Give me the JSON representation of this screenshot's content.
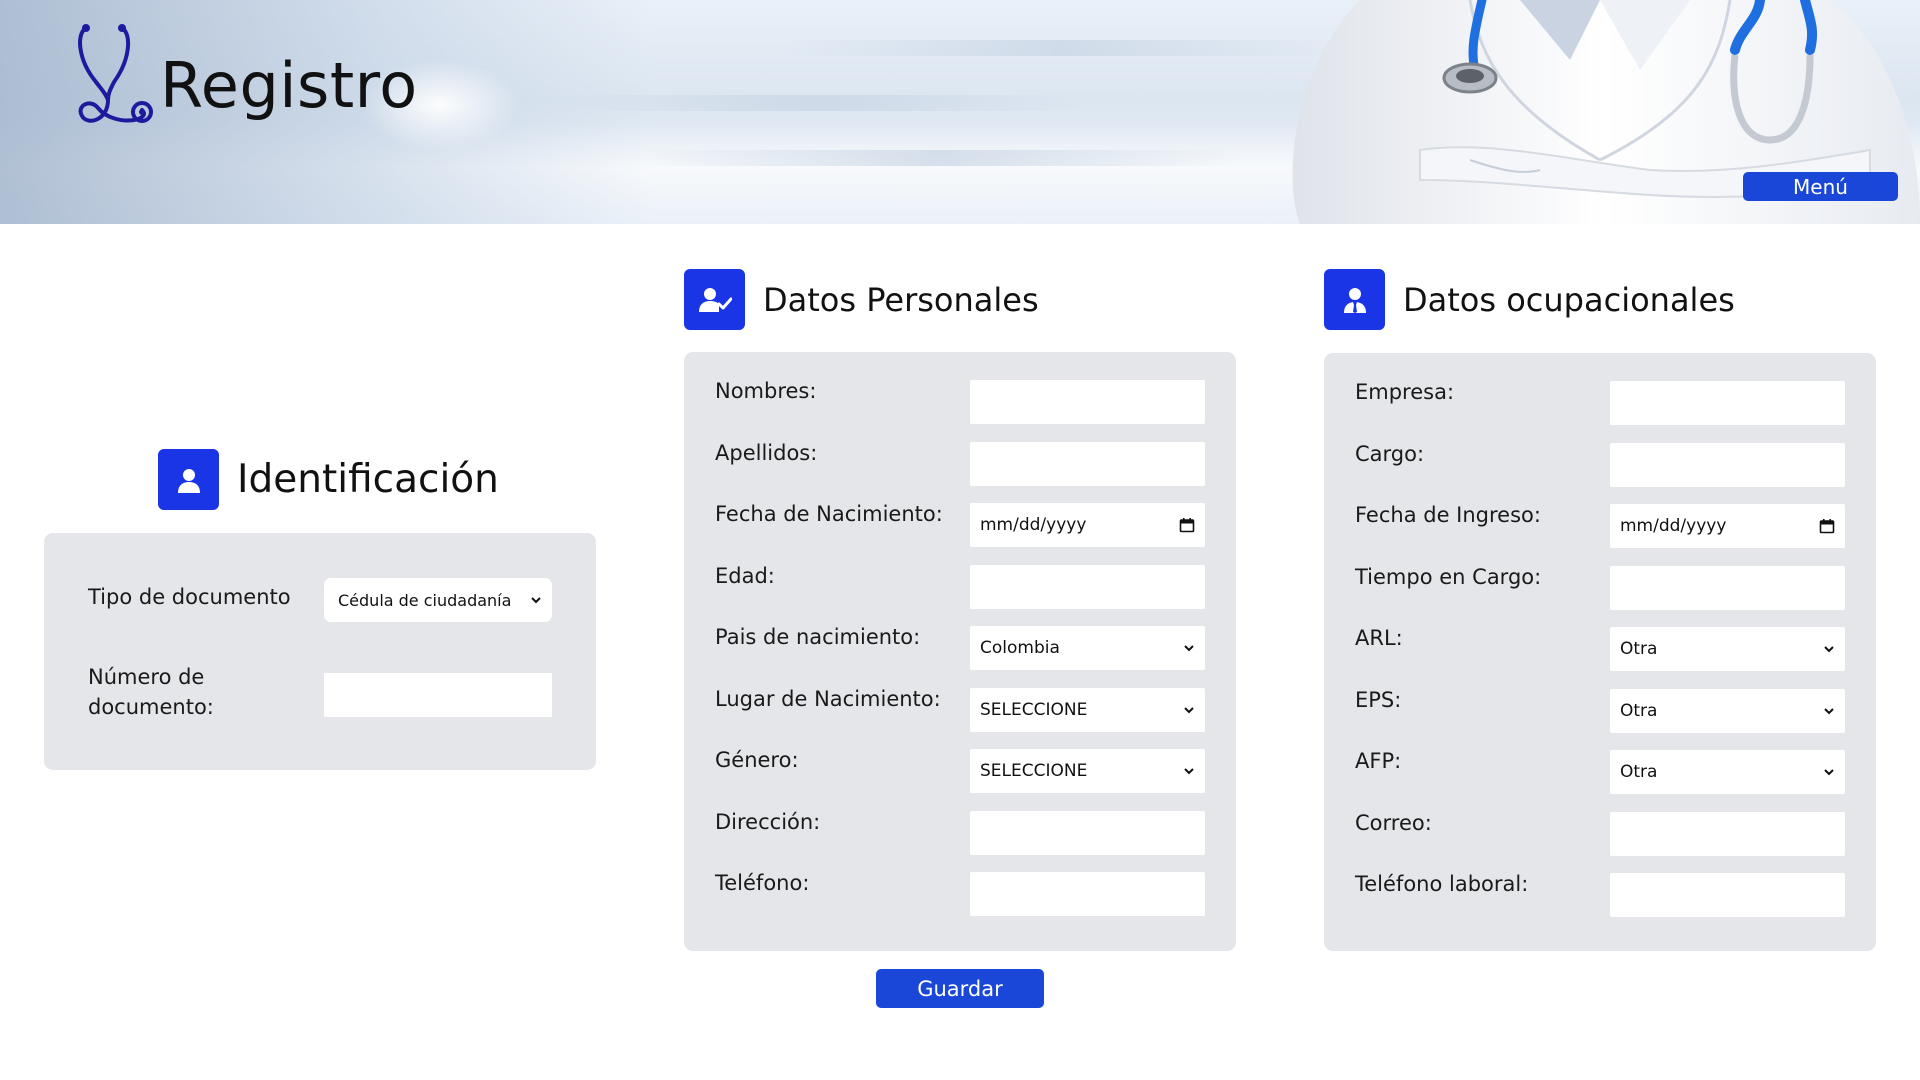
{
  "header": {
    "title": "Registro",
    "menu_label": "Menú"
  },
  "identificacion": {
    "title": "Identificación",
    "icon": "user-icon",
    "tipo_label": "Tipo de documento",
    "tipo_value": "Cédula de ciudadanía",
    "numero_label_line1": "Número de",
    "numero_label_line2": "documento:",
    "numero_value": ""
  },
  "personales": {
    "title": "Datos Personales",
    "icon": "user-check-icon",
    "fields": [
      {
        "label": "Nombres:",
        "type": "text",
        "value": ""
      },
      {
        "label": "Apellidos:",
        "type": "text",
        "value": ""
      },
      {
        "label": "Fecha de Nacimiento:",
        "type": "date",
        "value": "mm/dd/yyyy"
      },
      {
        "label": "Edad:",
        "type": "text",
        "value": ""
      },
      {
        "label": "Pais de nacimiento:",
        "type": "select",
        "value": "Colombia"
      },
      {
        "label": "Lugar de Nacimiento:",
        "type": "select",
        "value": "SELECCIONE"
      },
      {
        "label": "Género:",
        "type": "select",
        "value": "SELECCIONE"
      },
      {
        "label": "Dirección:",
        "type": "text",
        "value": ""
      },
      {
        "label": "Teléfono:",
        "type": "text",
        "value": ""
      }
    ]
  },
  "ocupacionales": {
    "title": "Datos ocupacionales",
    "icon": "user-tie-icon",
    "fields": [
      {
        "label": "Empresa:",
        "type": "text",
        "value": ""
      },
      {
        "label": "Cargo:",
        "type": "text",
        "value": ""
      },
      {
        "label": "Fecha de Ingreso:",
        "type": "date",
        "value": "mm/dd/yyyy"
      },
      {
        "label": "Tiempo en Cargo:",
        "type": "text",
        "value": ""
      },
      {
        "label": "ARL:",
        "type": "select",
        "value": "Otra"
      },
      {
        "label": "EPS:",
        "type": "select",
        "value": "Otra"
      },
      {
        "label": "AFP:",
        "type": "select",
        "value": "Otra"
      },
      {
        "label": "Correo:",
        "type": "text",
        "value": ""
      },
      {
        "label": "Teléfono laboral:",
        "type": "text",
        "value": ""
      }
    ]
  },
  "actions": {
    "save_label": "Guardar"
  },
  "colors": {
    "accent": "#1a47d8",
    "icon_bg": "#1a35e6",
    "panel_bg": "#e5e6ea"
  }
}
